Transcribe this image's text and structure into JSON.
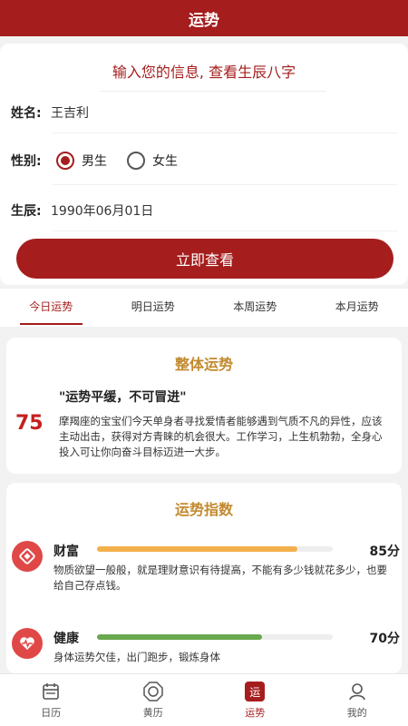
{
  "header": {
    "title": "运势"
  },
  "form": {
    "title": "输入您的信息, 查看生辰八字",
    "name_label": "姓名:",
    "name_value": "王吉利",
    "gender_label": "性别:",
    "gender_options": [
      "男生",
      "女生"
    ],
    "gender_selected": "男生",
    "birth_label": "生辰:",
    "birth_value": "1990年06月01日",
    "submit_label": "立即查看"
  },
  "tabs": [
    {
      "label": "今日运势",
      "active": true
    },
    {
      "label": "明日运势",
      "active": false
    },
    {
      "label": "本周运势",
      "active": false
    },
    {
      "label": "本月运势",
      "active": false
    }
  ],
  "overall": {
    "title": "整体运势",
    "score": "75",
    "slogan": "\"运势平缓，不可冒进\"",
    "description": "摩羯座的宝宝们今天单身者寻找爱情者能够遇到气质不凡的异性，应该主动出击，获得对方青睐的机会很大。工作学习，上生机勃勃，全身心投入可让你向奋斗目标迈进一大步。"
  },
  "index": {
    "title": "运势指数",
    "items": [
      {
        "name": "财富",
        "score": "85分",
        "value": 85,
        "color": "#f2b04c",
        "icon": "wealth-icon",
        "description": "物质欲望一般般，就是理财意识有待提高，不能有多少钱就花多少，也要给自己存点钱。"
      },
      {
        "name": "健康",
        "score": "70分",
        "value": 70,
        "color": "#6aa84f",
        "icon": "heart-icon",
        "description": "身体运势欠佳，出门跑步，锻炼身体"
      }
    ]
  },
  "bottom_nav": [
    {
      "label": "日历",
      "icon": "calendar-icon",
      "active": false
    },
    {
      "label": "黄历",
      "icon": "almanac-icon",
      "active": false
    },
    {
      "label": "运势",
      "icon": "fortune-icon",
      "active": true,
      "badge": "运"
    },
    {
      "label": "我的",
      "icon": "profile-icon",
      "active": false
    }
  ],
  "colors": {
    "primary": "#a51d1d",
    "accent_gold": "#c28a2f",
    "score_red": "#c42020"
  }
}
